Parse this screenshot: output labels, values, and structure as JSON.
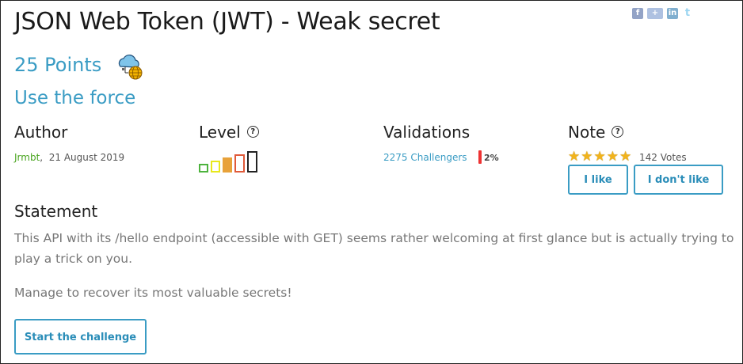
{
  "challenge": {
    "title": "JSON Web Token (JWT) - Weak secret",
    "points": "25 Points",
    "subtitle": "Use the force",
    "category_icon": "web-server-icon"
  },
  "social": [
    "facebook-icon",
    "google-plus-icon",
    "linkedin-icon",
    "twitter-icon"
  ],
  "columns": {
    "author_label": "Author",
    "level_label": "Level",
    "validations_label": "Validations",
    "note_label": "Note",
    "help_glyph": "?"
  },
  "author": {
    "name": "Jrmbt",
    "separator": ",",
    "date": "21 August 2019"
  },
  "level": {
    "current": 5,
    "max": 5,
    "colors": [
      "#4db33d",
      "#e8e81c",
      "#e8a23a",
      "#e05a3a",
      "#222222"
    ]
  },
  "validations": {
    "challengers": "2275 Challengers",
    "percent": "2%",
    "bar_color": "#ee3333"
  },
  "note": {
    "stars": 5,
    "star_glyph": "★",
    "votes": "142 Votes",
    "like_label": "I like",
    "dislike_label": "I don't like"
  },
  "statement": {
    "heading": "Statement",
    "paragraph1": "This API with its /hello endpoint (accessible with GET) seems rather welcoming at first glance but is actually trying to play a trick on you.",
    "paragraph2": "Manage to recover its most valuable secrets!"
  },
  "actions": {
    "start_label": "Start the challenge"
  },
  "colors": {
    "accent": "#3a9cc4",
    "author_link": "#4aa520"
  }
}
